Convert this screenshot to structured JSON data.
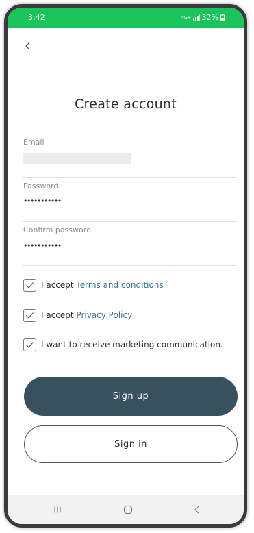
{
  "status_bar": {
    "time": "3:42",
    "network": "4G+",
    "battery": "32%",
    "color": "#19c55a"
  },
  "header": {
    "back_icon": "chevron-left-icon"
  },
  "title": "Create account",
  "form": {
    "email": {
      "label": "Email",
      "value": ""
    },
    "password": {
      "label": "Password",
      "value": "•••••••••••"
    },
    "confirm_password": {
      "label": "Confirm password",
      "value": "•••••••••••"
    }
  },
  "checkboxes": [
    {
      "prefix": "I accept ",
      "link": "Terms and conditions",
      "checked": true
    },
    {
      "prefix": "I accept ",
      "link": "Privacy Policy",
      "checked": true
    },
    {
      "prefix": "I want to receive marketing communication.",
      "link": "",
      "checked": true
    }
  ],
  "buttons": {
    "signup_label": "Sign up",
    "signin_label": "Sign in"
  },
  "colors": {
    "primary": "#38505f",
    "link": "#3d6e9a"
  },
  "nav_bar": {
    "recents_icon": "recents-icon",
    "home_icon": "home-icon",
    "back_icon": "back-icon"
  }
}
